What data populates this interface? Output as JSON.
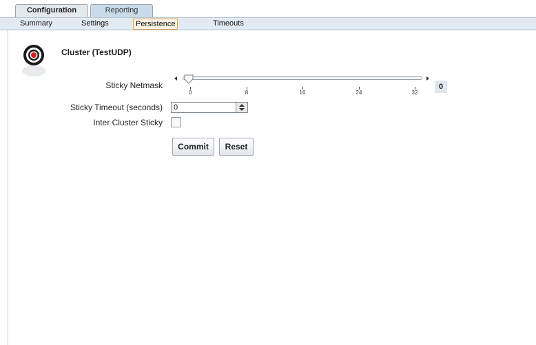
{
  "top_tabs": [
    {
      "label": "Configuration",
      "active": true
    },
    {
      "label": "Reporting",
      "active": false
    }
  ],
  "sub_tabs": [
    {
      "label": "Summary"
    },
    {
      "label": "Settings"
    },
    {
      "label": "Persistence",
      "selected": true
    },
    {
      "label": "Timeouts"
    }
  ],
  "icons": {
    "cluster": "target-icon"
  },
  "colors": {
    "selected_tab_border": "#e3a34a",
    "subbar": "#e3ebf2",
    "active_tab": "#e4e9ee",
    "inactive_tab": "#c9dbe9",
    "target_red": "#d61f1f"
  },
  "cluster": {
    "title": "Cluster (TestUDP)"
  },
  "form": {
    "sticky_netmask": {
      "label": "Sticky Netmask",
      "value": "0",
      "min": 0,
      "max": 32,
      "ticks": [
        "0",
        "8",
        "16",
        "24",
        "32"
      ]
    },
    "sticky_timeout": {
      "label": "Sticky Timeout (seconds)",
      "value": "0"
    },
    "inter_cluster_sticky": {
      "label": "Inter Cluster Sticky",
      "checked": false
    }
  },
  "buttons": {
    "commit": "Commit",
    "reset": "Reset"
  }
}
